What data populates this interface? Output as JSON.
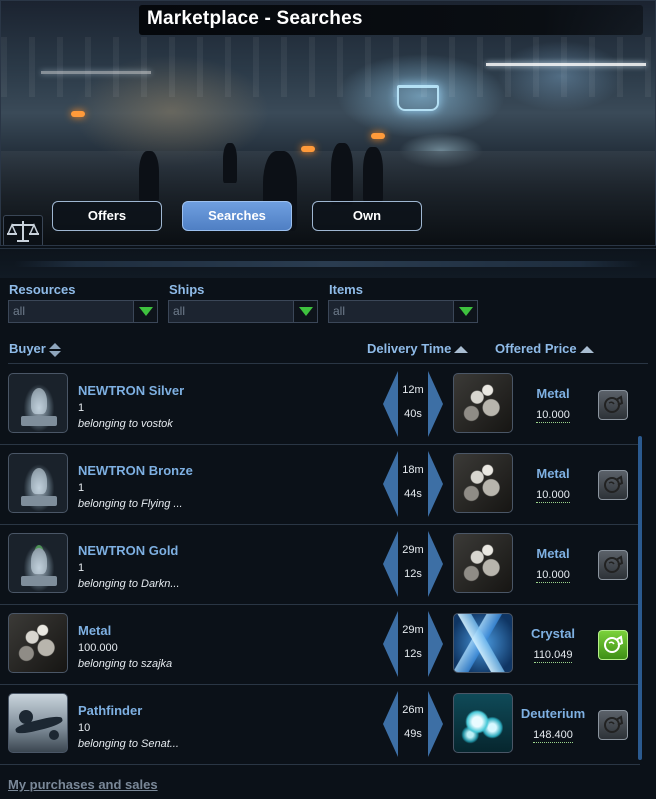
{
  "window": {
    "title": "Marketplace - Searches"
  },
  "tabs": [
    {
      "label": "Offers",
      "active": false
    },
    {
      "label": "Searches",
      "active": true
    },
    {
      "label": "Own",
      "active": false
    }
  ],
  "filters": {
    "resources": {
      "label": "Resources",
      "value": "all"
    },
    "ships": {
      "label": "Ships",
      "value": "all"
    },
    "items": {
      "label": "Items",
      "value": "all"
    }
  },
  "columns": {
    "buyer": "Buyer",
    "delivery_time": "Delivery Time",
    "offered_price": "Offered Price"
  },
  "rows": [
    {
      "item": "NEWTRON Silver",
      "icon": "ship-module-icon",
      "quantity": "1",
      "owner": "belonging to vostok",
      "delivery_min": "12m",
      "delivery_sec": "40s",
      "price_resource": "Metal",
      "price_icon": "metal-icon",
      "price_amount": "10.000",
      "accept_enabled": false
    },
    {
      "item": "NEWTRON Bronze",
      "icon": "ship-module-icon",
      "quantity": "1",
      "owner": "belonging to Flying ...",
      "delivery_min": "18m",
      "delivery_sec": "44s",
      "price_resource": "Metal",
      "price_icon": "metal-icon",
      "price_amount": "10.000",
      "accept_enabled": false
    },
    {
      "item": "NEWTRON Gold",
      "icon": "ship-module-icon",
      "quantity": "1",
      "owner": "belonging to Darkn...",
      "delivery_min": "29m",
      "delivery_sec": "12s",
      "price_resource": "Metal",
      "price_icon": "metal-icon",
      "price_amount": "10.000",
      "accept_enabled": false
    },
    {
      "item": "Metal",
      "icon": "metal-icon",
      "quantity": "100.000",
      "owner": "belonging to szajka",
      "delivery_min": "29m",
      "delivery_sec": "12s",
      "price_resource": "Crystal",
      "price_icon": "crystal-icon",
      "price_amount": "110.049",
      "accept_enabled": true
    },
    {
      "item": "Pathfinder",
      "icon": "pathfinder-ship-icon",
      "quantity": "10",
      "owner": "belonging to Senat...",
      "delivery_min": "26m",
      "delivery_sec": "49s",
      "price_resource": "Deuterium",
      "price_icon": "deuterium-icon",
      "price_amount": "148.400",
      "accept_enabled": false
    }
  ],
  "footer": {
    "link": "My purchases and sales"
  },
  "colors": {
    "accent": "#7eb0e2",
    "active_tab": "#5f8fd4",
    "accept_ok": "#5bb22a",
    "dropdown_arrow": "#3ec23e"
  }
}
